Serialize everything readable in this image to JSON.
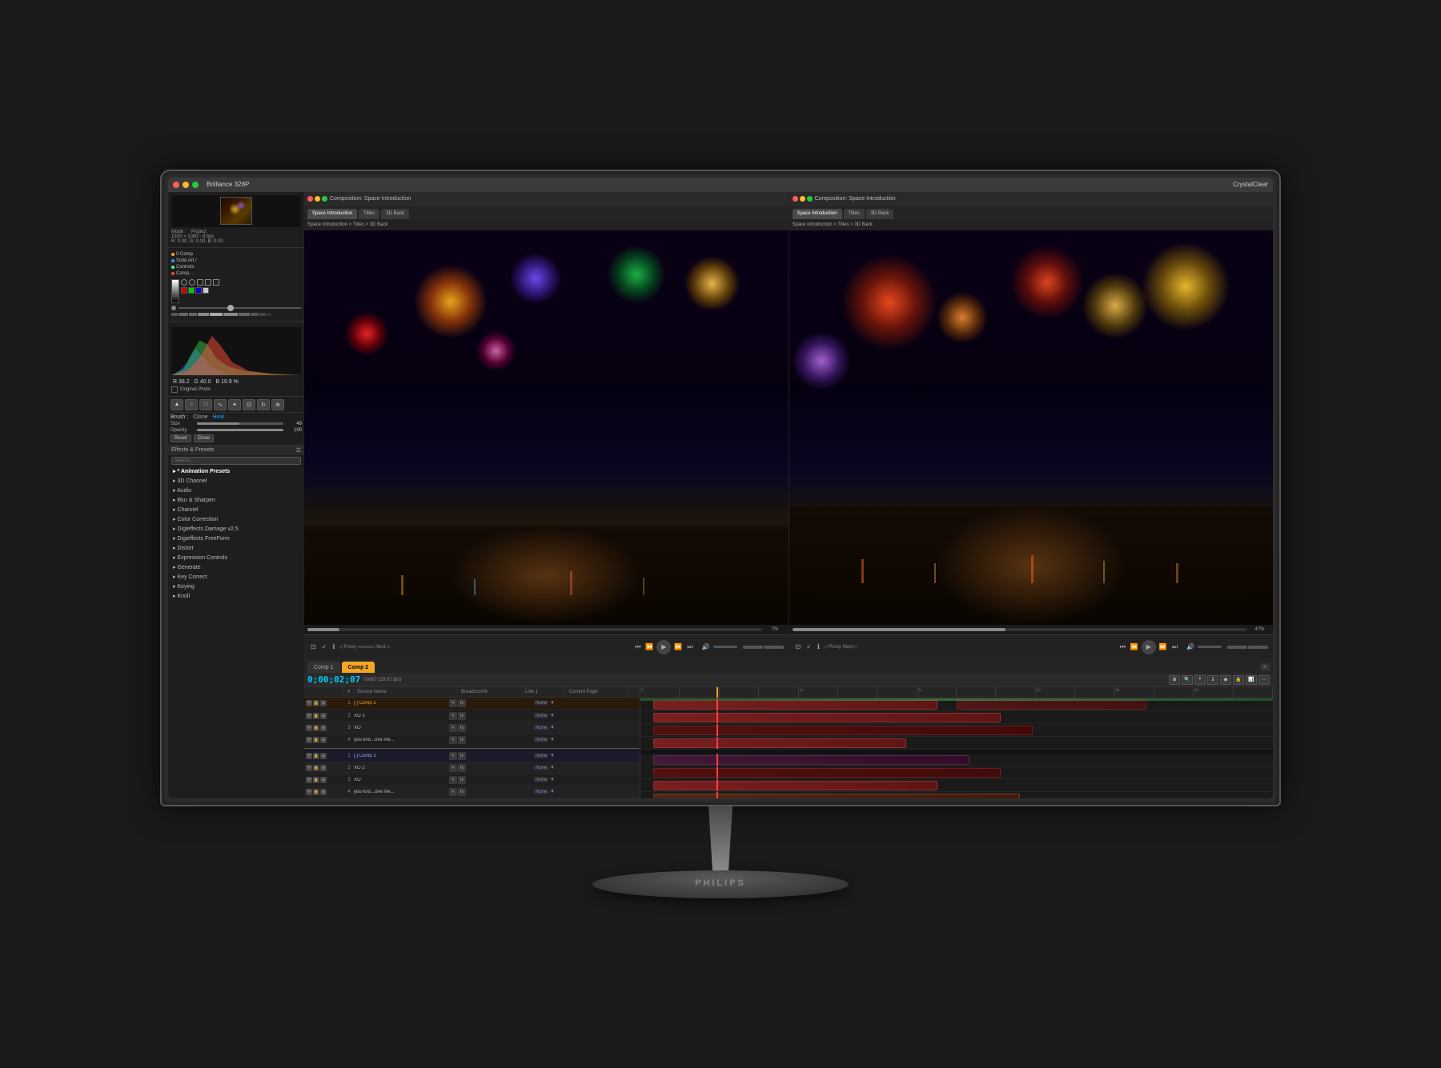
{
  "monitor": {
    "brand": "Brilliance 328P",
    "tagline": "CrystalClear"
  },
  "topbar": {
    "title": "Project"
  },
  "left_panel": {
    "histogram": {
      "r_value": "36.2",
      "g_value": "40.0",
      "b_value": "19.9",
      "r_label": "R",
      "g_label": "G",
      "b_label": "B",
      "percent": "%"
    },
    "photo_label": "Original Photo",
    "brush": {
      "label": "Brush :",
      "clone": "Clone",
      "heal": "Heal",
      "size_label": "Size",
      "size_value": "49",
      "opacity_label": "Opacity",
      "opacity_value": "100",
      "reset": "Reset",
      "close": "Close"
    },
    "effects_presets": {
      "title": "Effects & Presets",
      "search_placeholder": "Search...",
      "items": [
        "* Animation Presets",
        "3D Channel",
        "Audio",
        "Blur & Sharpen",
        "Channel",
        "Color Correction",
        "Digieffects Damage v2.5",
        "Digieffects FreeForm",
        "Distort",
        "Expression Controls",
        "Generate",
        "Key Correct",
        "Keying",
        "Knoll"
      ]
    }
  },
  "comp_left": {
    "title": "Composition: Space Introduction",
    "tabs": [
      "Space Introduction",
      "Titles",
      "3D Back"
    ],
    "breadcrumb": "Space Introduction > Titles > 3D Back",
    "progress_pct": "7%"
  },
  "comp_right": {
    "title": "Composition: Space Introduction",
    "tabs": [
      "Space Introduction",
      "Titles",
      "3D Back"
    ],
    "breadcrumb": "Space Introduction > Titles > 3D Back",
    "progress_pct": "47%"
  },
  "timeline": {
    "tabs": [
      "Comp 1",
      "Comp 2"
    ],
    "active_tab": "Comp 2",
    "timecode": "0;00;02;07",
    "frames": "00067 (29.97 fps)",
    "columns": [
      "Source Name",
      "Breadcrumb",
      "Link 1",
      "Current Page"
    ],
    "rows": [
      {
        "num": "1",
        "name": "[:] Comp 2",
        "breadcrumb": "",
        "link1": "None",
        "curpage": ""
      },
      {
        "num": "2",
        "name": "XO 2",
        "breadcrumb": "",
        "link1": "None",
        "curpage": ""
      },
      {
        "num": "3",
        "name": "XO",
        "breadcrumb": "",
        "link1": "None",
        "curpage": ""
      },
      {
        "num": "4",
        "name": "you kno...ove me...",
        "breadcrumb": "",
        "link1": "None",
        "curpage": ""
      },
      {
        "num": "1",
        "name": "[:] Comp 2",
        "breadcrumb": "",
        "link1": "None",
        "curpage": ""
      },
      {
        "num": "2",
        "name": "XO 2",
        "breadcrumb": "",
        "link1": "None",
        "curpage": ""
      },
      {
        "num": "3",
        "name": "XO",
        "breadcrumb": "",
        "link1": "None",
        "curpage": ""
      },
      {
        "num": "4",
        "name": "you kno...ove me...",
        "breadcrumb": "",
        "link1": "None",
        "curpage": ""
      }
    ]
  },
  "playback": {
    "left_controls": [
      "⏮",
      "◀",
      "▶",
      "▶▶"
    ],
    "play": "▶",
    "right_controls": [
      "⏭"
    ],
    "volume": "🔊"
  },
  "colors": {
    "accent_orange": "#f5a623",
    "accent_blue": "#00ccff",
    "bg_dark": "#1a1a1a",
    "panel_bg": "#1e1e1e"
  }
}
